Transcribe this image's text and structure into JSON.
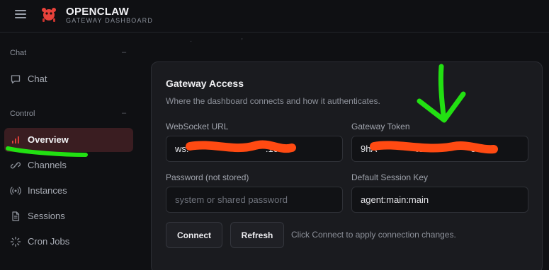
{
  "header": {
    "brand_name": "OPENCLAW",
    "brand_subtitle": "GATEWAY DASHBOARD",
    "menu_icon": "hamburger-icon",
    "logo_icon": "red-crab-logo"
  },
  "sidebar": {
    "sections": [
      {
        "title": "Chat",
        "collapse_symbol": "–",
        "items": [
          {
            "label": "Chat",
            "icon": "chat-bubble-icon",
            "active": false
          }
        ]
      },
      {
        "title": "Control",
        "collapse_symbol": "–",
        "items": [
          {
            "label": "Overview",
            "icon": "bar-chart-icon",
            "active": true
          },
          {
            "label": "Channels",
            "icon": "link-icon",
            "active": false
          },
          {
            "label": "Instances",
            "icon": "radio-waves-icon",
            "active": false
          },
          {
            "label": "Sessions",
            "icon": "document-icon",
            "active": false
          },
          {
            "label": "Cron Jobs",
            "icon": "spinner-icon",
            "active": false
          }
        ]
      }
    ]
  },
  "gateway_access": {
    "title": "Gateway Access",
    "subtitle": "Where the dashboard connects and how it authenticates.",
    "websocket_url": {
      "label": "WebSocket URL",
      "value": "ws:                              :10"
    },
    "gateway_token": {
      "label": "Gateway Token",
      "value": "9hA               vB0w             e6uVl"
    },
    "password": {
      "label": "Password (not stored)",
      "placeholder": "system or shared password",
      "value": ""
    },
    "session_key": {
      "label": "Default Session Key",
      "value": "agent:main:main"
    },
    "connect_label": "Connect",
    "refresh_label": "Refresh",
    "hint": "Click Connect to apply connection changes."
  },
  "colors": {
    "accent": "#e8423b",
    "active_nav_bg": "#3a1d21",
    "redaction": "#ff4a12",
    "annotation_green": "#22e012"
  }
}
